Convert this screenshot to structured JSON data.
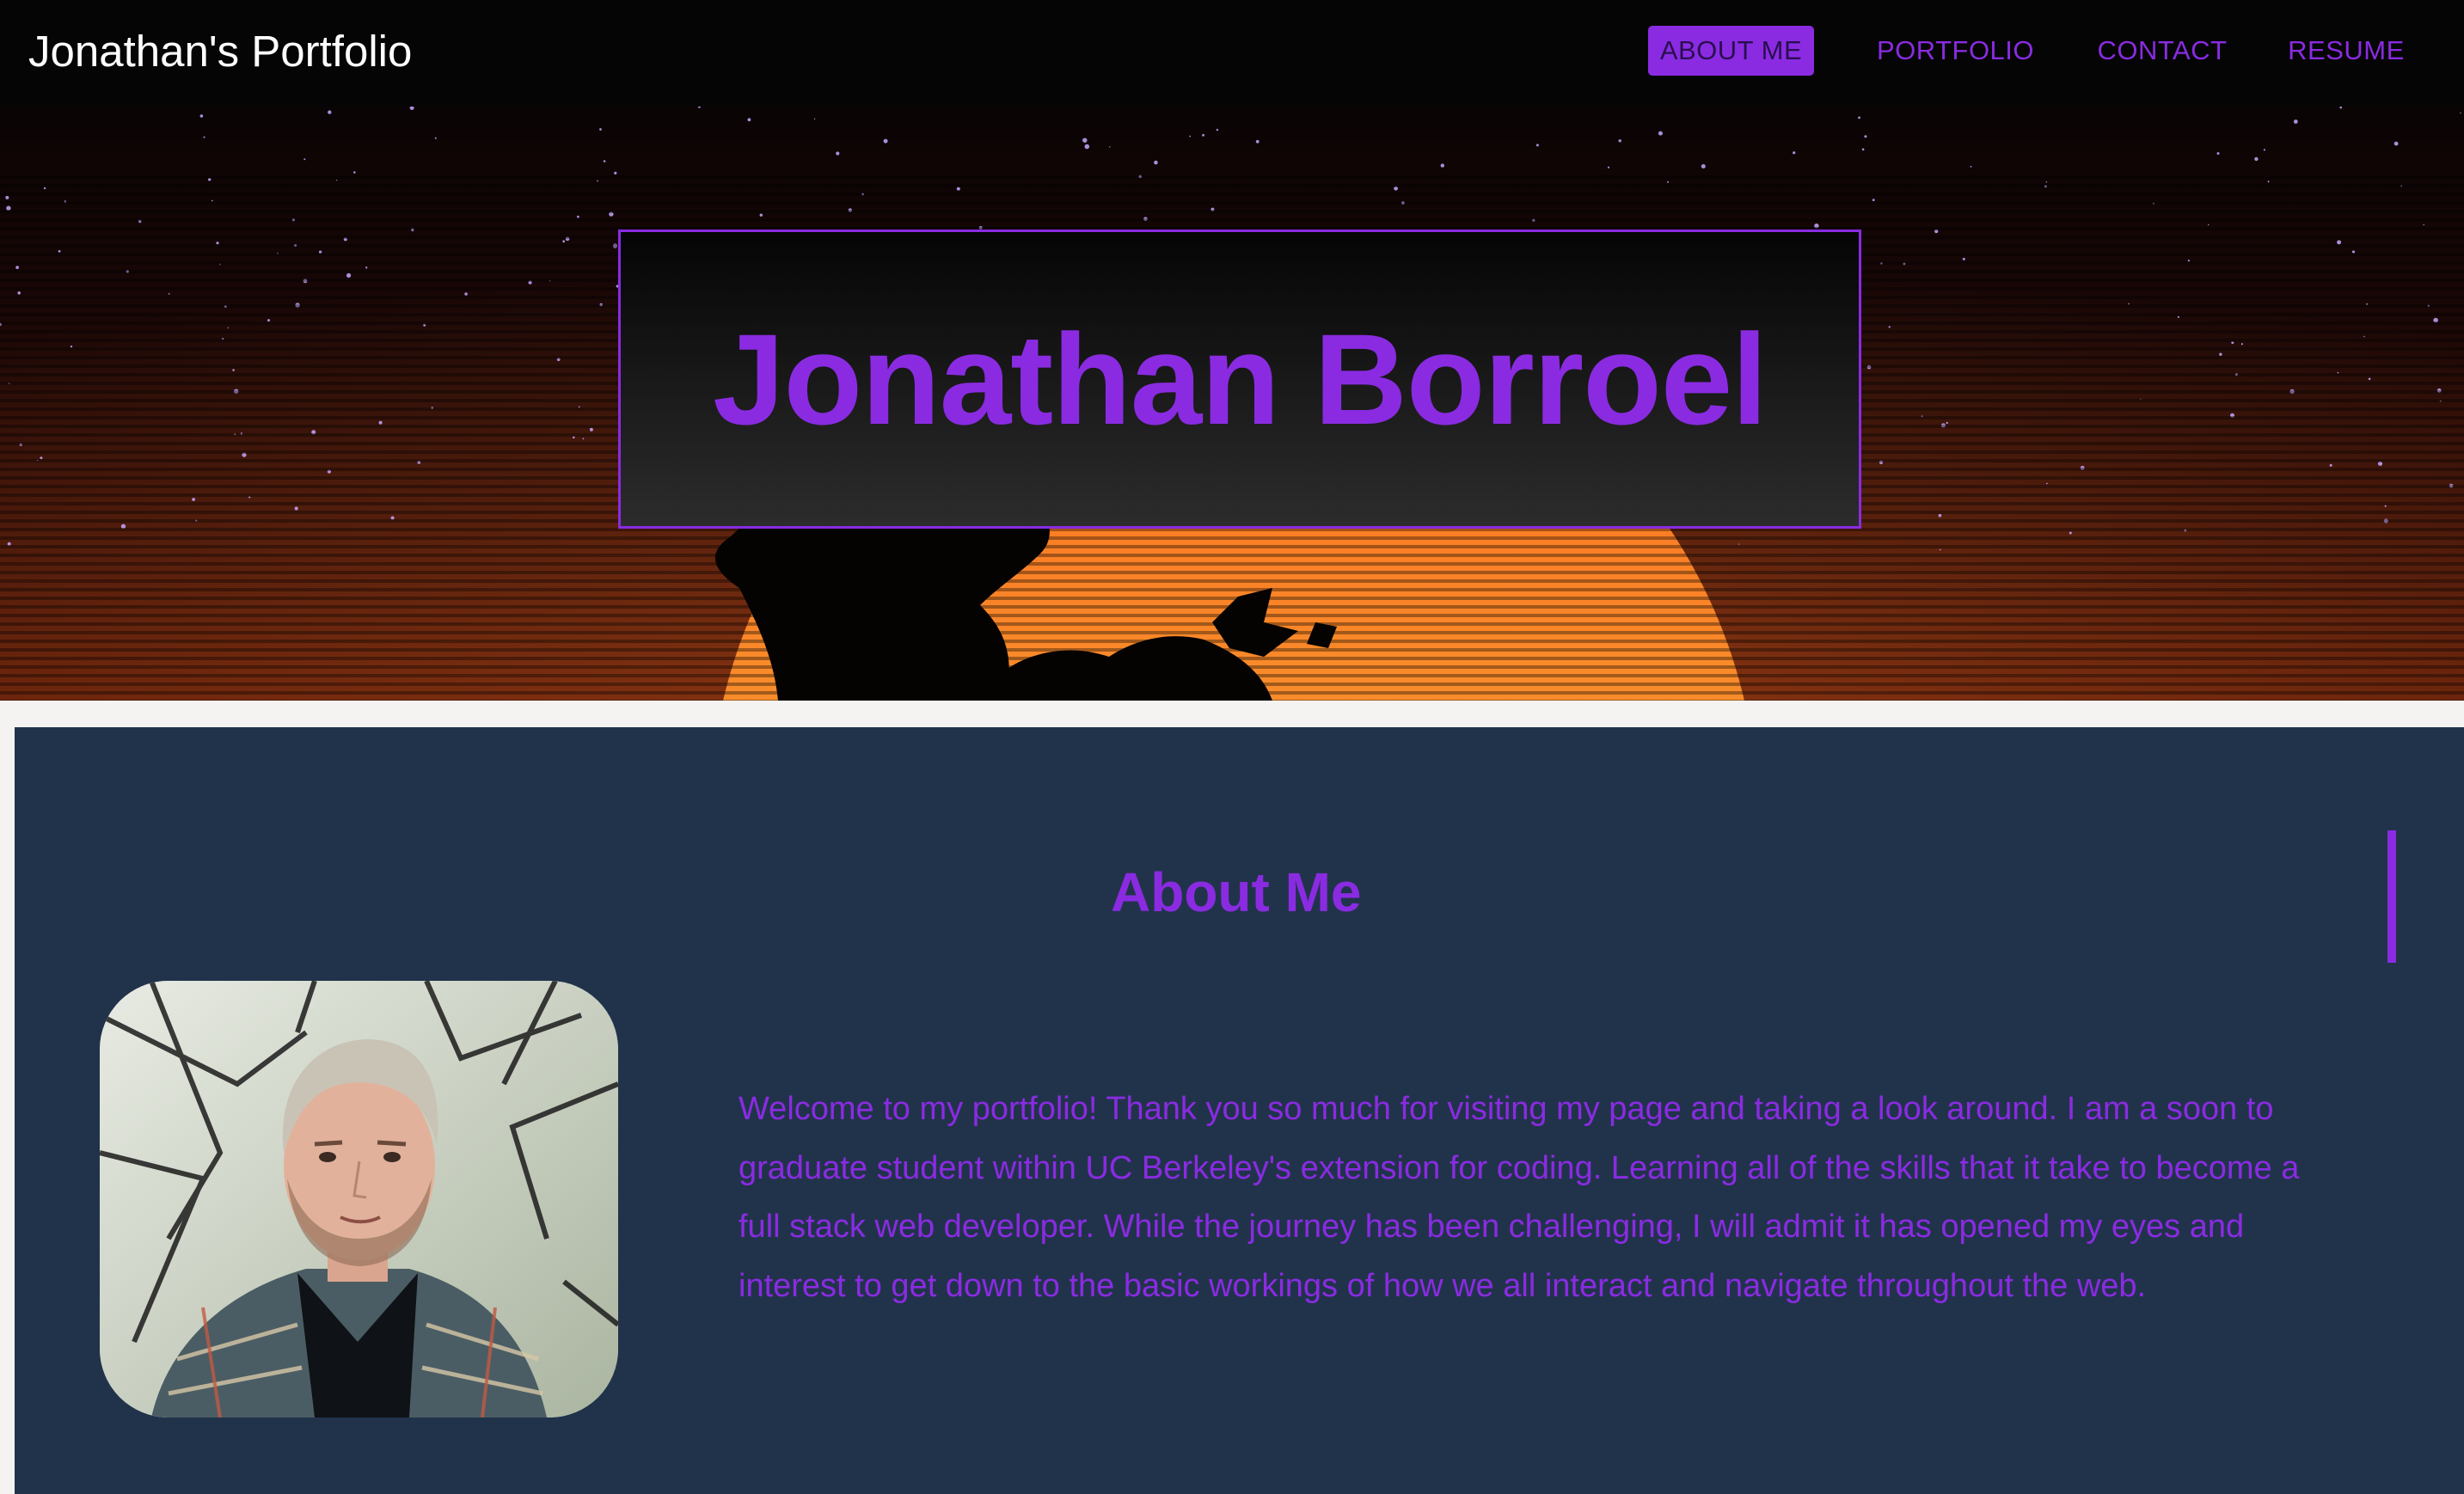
{
  "nav": {
    "brand": "Jonathan's Portfolio",
    "links": [
      {
        "label": "ABOUT ME",
        "active": true
      },
      {
        "label": "PORTFOLIO",
        "active": false
      },
      {
        "label": "CONTACT",
        "active": false
      },
      {
        "label": "RESUME",
        "active": false
      }
    ]
  },
  "hero": {
    "name": "Jonathan Borroel"
  },
  "about": {
    "heading": "About Me",
    "bio": "Welcome to my portfolio! Thank you so much for visiting my page and taking a look around. I am a soon to graduate student within UC Berkeley's extension for coding. Learning all of the skills that it take to become a full stack web developer. While the journey has been challenging, I will admit it has opened my eyes and interest to get down to the basic workings of how we all interact and navigate throughout the web."
  },
  "colors": {
    "accent": "#8a2be2",
    "navbar": "#050505",
    "about_bg": "#21334b",
    "page_bg": "#f5f3f2",
    "sun": "#f5a43a"
  }
}
